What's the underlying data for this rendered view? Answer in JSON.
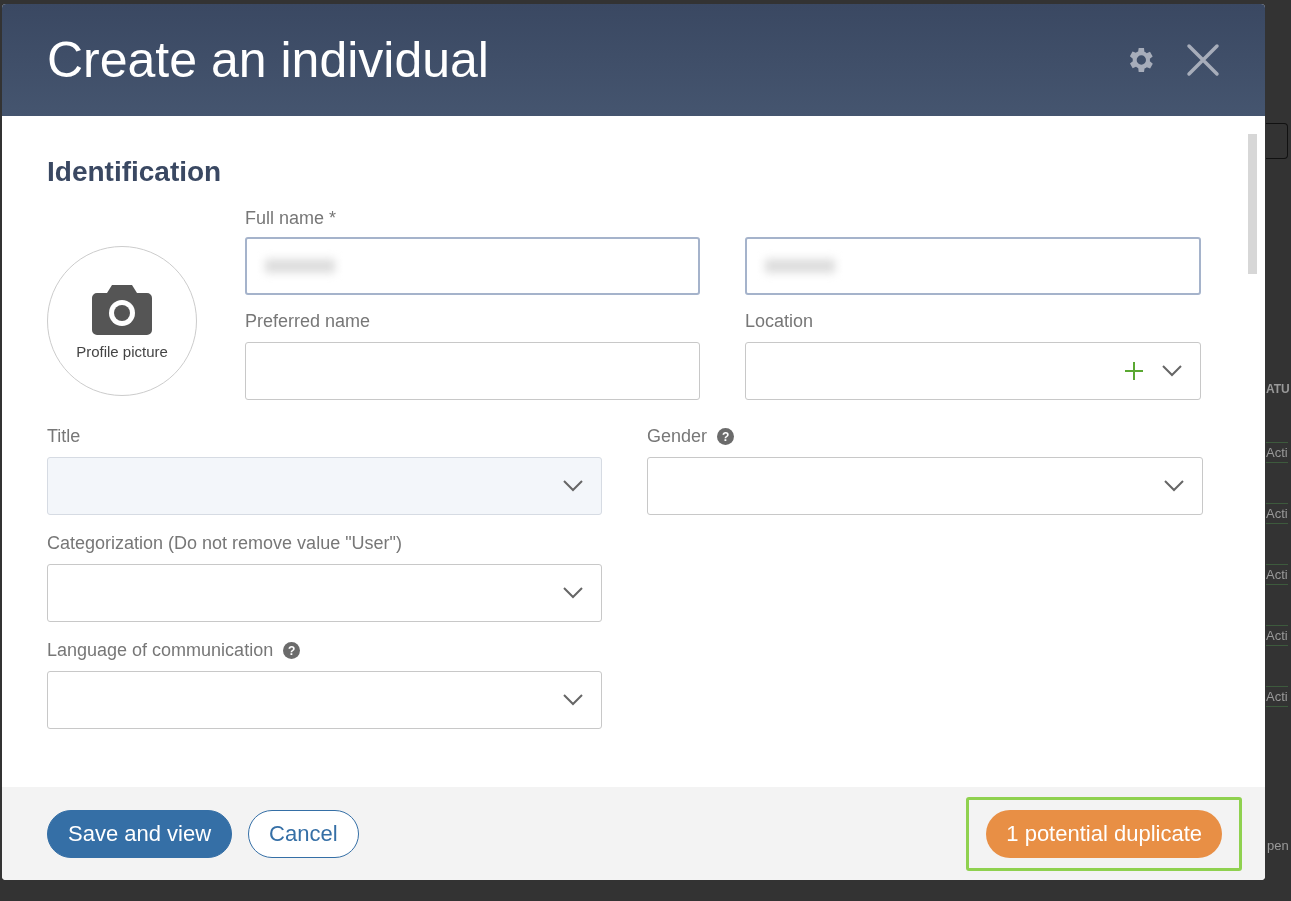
{
  "background": {
    "column_heading": "ATU",
    "status_badges": [
      "Acti",
      "Acti",
      "Acti",
      "Acti",
      "Acti"
    ],
    "footer_text": "pen"
  },
  "dialog": {
    "title": "Create an individual",
    "section_title": "Identification",
    "profile_picture": {
      "label": "Profile picture"
    },
    "full_name": {
      "label": "Full name *"
    },
    "preferred_name": {
      "label": "Preferred name"
    },
    "location": {
      "label": "Location"
    },
    "title_field": {
      "label": "Title",
      "disabled": true
    },
    "gender": {
      "label": "Gender",
      "help_icon": "?"
    },
    "categorization": {
      "label": "Categorization (Do not remove value \"User\")"
    },
    "language": {
      "label": "Language of communication",
      "help_icon": "?"
    },
    "buttons": [
      {
        "kind": "primary",
        "label": "Save and view"
      },
      {
        "kind": "secondary",
        "label": "Cancel"
      }
    ],
    "duplicate_badge": {
      "label": "1 potential duplicate",
      "highlighted": true
    }
  }
}
